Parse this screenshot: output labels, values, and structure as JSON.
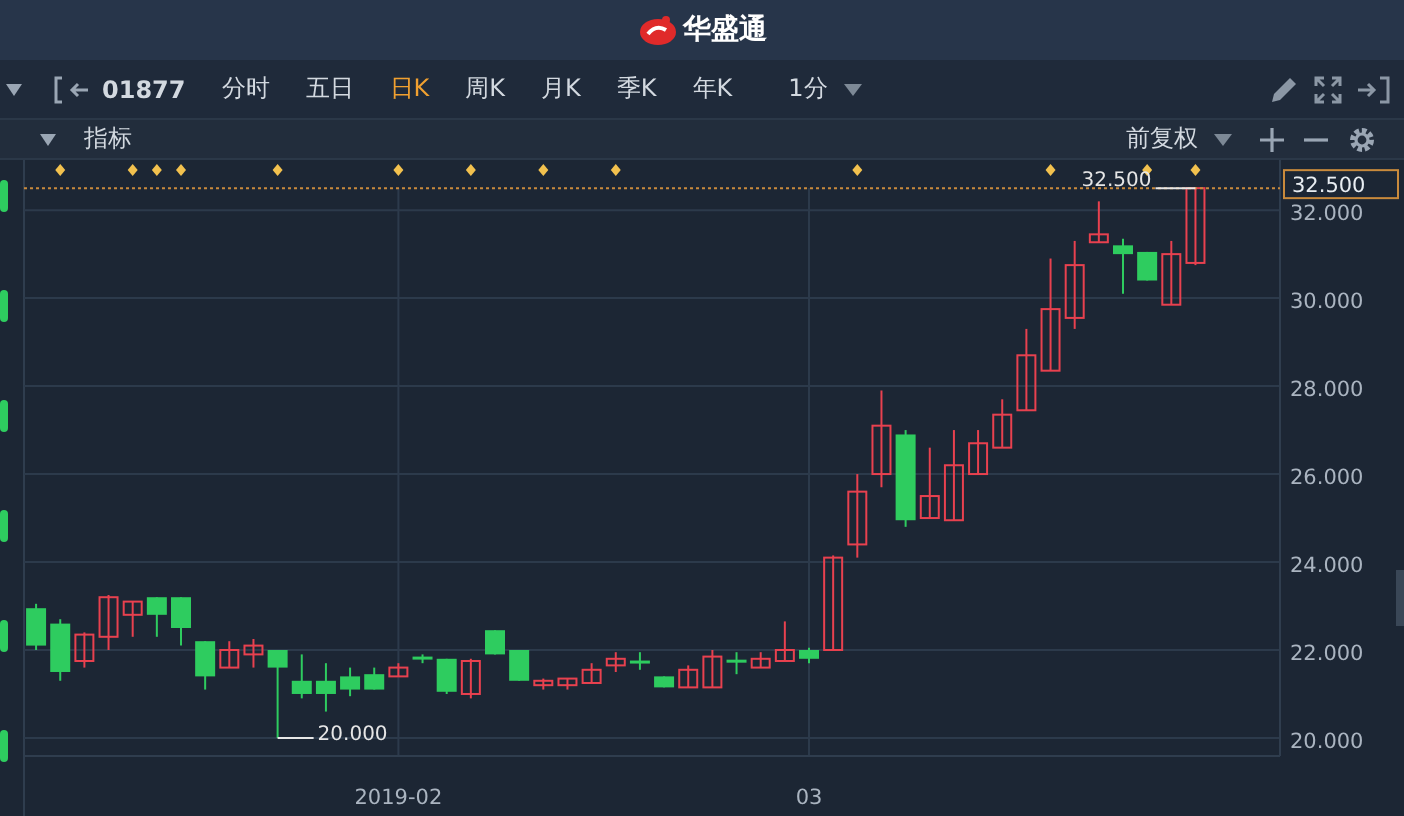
{
  "header": {
    "logo_text": "华盛通"
  },
  "toolbar": {
    "symbol": "01877",
    "periods": [
      {
        "label": "分时",
        "selected": false
      },
      {
        "label": "五日",
        "selected": false
      },
      {
        "label": "日K",
        "selected": true
      },
      {
        "label": "周K",
        "selected": false
      },
      {
        "label": "月K",
        "selected": false
      },
      {
        "label": "季K",
        "selected": false
      },
      {
        "label": "年K",
        "selected": false
      }
    ],
    "interval": "1分"
  },
  "indicator_bar": {
    "label": "指标",
    "adjustment": "前复权"
  },
  "chart_data": {
    "type": "candlestick",
    "ylim": [
      19.59,
      33.14
    ],
    "categories": [
      null,
      null,
      null,
      null,
      null,
      null,
      null,
      null,
      null,
      null,
      null,
      null,
      null,
      null,
      null,
      "2019-02",
      null,
      null,
      null,
      null,
      null,
      null,
      null,
      null,
      null,
      null,
      null,
      null,
      null,
      null,
      null,
      null,
      "03",
      null,
      null,
      null,
      null,
      null,
      null,
      null,
      null,
      null,
      null,
      null,
      null,
      null,
      null,
      null,
      null
    ],
    "ohlc": [
      [
        22.95,
        23.05,
        22.0,
        22.1
      ],
      [
        22.6,
        22.7,
        21.3,
        21.5
      ],
      [
        21.75,
        22.4,
        21.6,
        22.35
      ],
      [
        22.3,
        23.25,
        22.0,
        23.2
      ],
      [
        22.8,
        23.1,
        22.3,
        23.1
      ],
      [
        23.2,
        23.2,
        22.3,
        22.8
      ],
      [
        23.2,
        23.2,
        22.1,
        22.5
      ],
      [
        22.2,
        22.2,
        21.1,
        21.4
      ],
      [
        21.6,
        22.2,
        21.6,
        22.0
      ],
      [
        21.9,
        22.25,
        21.6,
        22.1
      ],
      [
        22.0,
        22.0,
        20.0,
        21.6
      ],
      [
        21.3,
        21.9,
        20.9,
        21.0
      ],
      [
        21.3,
        21.7,
        20.6,
        21.0
      ],
      [
        21.4,
        21.6,
        20.95,
        21.1
      ],
      [
        21.45,
        21.6,
        21.1,
        21.1
      ],
      [
        21.4,
        21.7,
        21.4,
        21.6
      ],
      [
        21.85,
        21.9,
        21.7,
        21.8
      ],
      [
        21.8,
        21.8,
        21.0,
        21.05
      ],
      [
        21.0,
        21.8,
        20.9,
        21.75
      ],
      [
        22.45,
        22.45,
        21.9,
        21.9
      ],
      [
        22.0,
        22.0,
        21.3,
        21.3
      ],
      [
        21.2,
        21.35,
        21.1,
        21.3
      ],
      [
        21.2,
        21.35,
        21.1,
        21.35
      ],
      [
        21.25,
        21.7,
        21.25,
        21.55
      ],
      [
        21.65,
        21.95,
        21.5,
        21.8
      ],
      [
        21.76,
        21.95,
        21.55,
        21.74
      ],
      [
        21.4,
        21.4,
        21.15,
        21.15
      ],
      [
        21.15,
        21.65,
        21.15,
        21.55
      ],
      [
        21.15,
        22.0,
        21.15,
        21.85
      ],
      [
        21.78,
        21.95,
        21.45,
        21.76
      ],
      [
        21.6,
        21.95,
        21.6,
        21.8
      ],
      [
        21.75,
        22.65,
        21.75,
        22.0
      ],
      [
        22.0,
        22.05,
        21.7,
        21.8
      ],
      [
        22.0,
        24.15,
        22.0,
        24.1
      ],
      [
        24.4,
        26.0,
        24.1,
        25.6
      ],
      [
        26.0,
        27.9,
        25.7,
        27.1
      ],
      [
        26.9,
        27.0,
        24.8,
        24.95
      ],
      [
        25.0,
        26.6,
        25.0,
        25.5
      ],
      [
        24.95,
        27.0,
        24.95,
        26.2
      ],
      [
        26.0,
        27.0,
        26.0,
        26.7
      ],
      [
        26.6,
        27.7,
        26.6,
        27.35
      ],
      [
        27.45,
        29.3,
        27.45,
        28.7
      ],
      [
        28.35,
        30.9,
        28.35,
        29.75
      ],
      [
        29.55,
        31.3,
        29.3,
        30.75
      ],
      [
        31.27,
        32.2,
        31.27,
        31.45
      ],
      [
        31.2,
        31.35,
        30.1,
        31.0
      ],
      [
        31.05,
        31.05,
        30.4,
        30.4
      ],
      [
        29.85,
        31.3,
        29.85,
        31.0
      ],
      [
        30.8,
        32.5,
        30.75,
        32.5
      ]
    ],
    "yticks": [
      {
        "value": 32,
        "label": "32.000"
      },
      {
        "value": 30,
        "label": "30.000"
      },
      {
        "value": 28,
        "label": "28.000"
      },
      {
        "value": 26,
        "label": "26.000"
      },
      {
        "value": 24,
        "label": "24.000"
      },
      {
        "value": 22,
        "label": "22.000"
      },
      {
        "value": 20,
        "label": "20.000"
      }
    ],
    "grid": true,
    "annotations": [
      "20.000",
      "32.500"
    ],
    "ref_lines": [
      {
        "axis": "y",
        "value": 32.5,
        "label": "32.500"
      }
    ]
  }
}
